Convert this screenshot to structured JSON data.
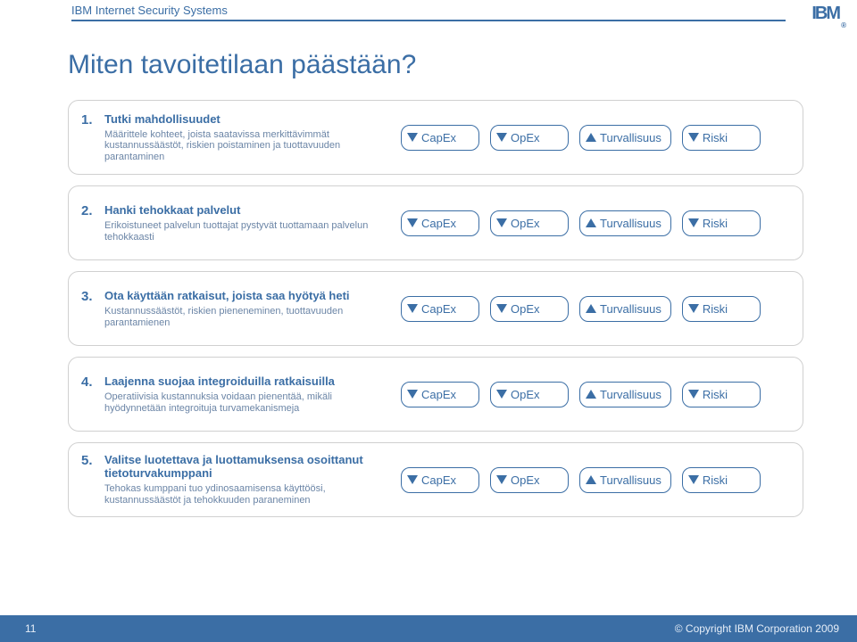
{
  "header": {
    "product": "IBM Internet Security Systems",
    "logo_text": "IBM",
    "reg": "®"
  },
  "title": "Miten tavoitetilaan päästään?",
  "badges_direction": [
    [
      "down",
      "down",
      "up",
      "down"
    ],
    [
      "down",
      "down",
      "up",
      "down"
    ],
    [
      "down",
      "down",
      "up",
      "down"
    ],
    [
      "down",
      "down",
      "up",
      "down"
    ],
    [
      "down",
      "down",
      "up",
      "down"
    ]
  ],
  "badge_labels": [
    "CapEx",
    "OpEx",
    "Turvallisuus",
    "Riski"
  ],
  "rows": [
    {
      "num": "1.",
      "headline": "Tutki mahdollisuudet",
      "sub": "Määrittele kohteet, joista saatavissa merkittävimmät kustannussäästöt, riskien poistaminen ja tuottavuuden parantaminen"
    },
    {
      "num": "2.",
      "headline": "Hanki tehokkaat palvelut",
      "sub": "Erikoistuneet palvelun tuottajat pystyvät tuottamaan palvelun tehokkaasti"
    },
    {
      "num": "3.",
      "headline": "Ota käyttään ratkaisut, joista saa hyötyä heti",
      "sub": "Kustannussäästöt, riskien pieneneminen, tuottavuuden parantamienen"
    },
    {
      "num": "4.",
      "headline": "Laajenna suojaa integroiduilla ratkaisuilla",
      "sub": "Operatiivisia kustannuksia voidaan pienentää, mikäli hyödynnetään integroituja turvamekanismeja"
    },
    {
      "num": "5.",
      "headline": "Valitse luotettava ja luottamuksensa osoittanut tietoturvakumppani",
      "sub": "Tehokas kumppani tuo ydinosaamisensa käyttöösi, kustannussäästöt ja tehokkuuden paraneminen"
    }
  ],
  "footer": {
    "page": "11",
    "copyright": "© Copyright IBM Corporation 2009"
  }
}
